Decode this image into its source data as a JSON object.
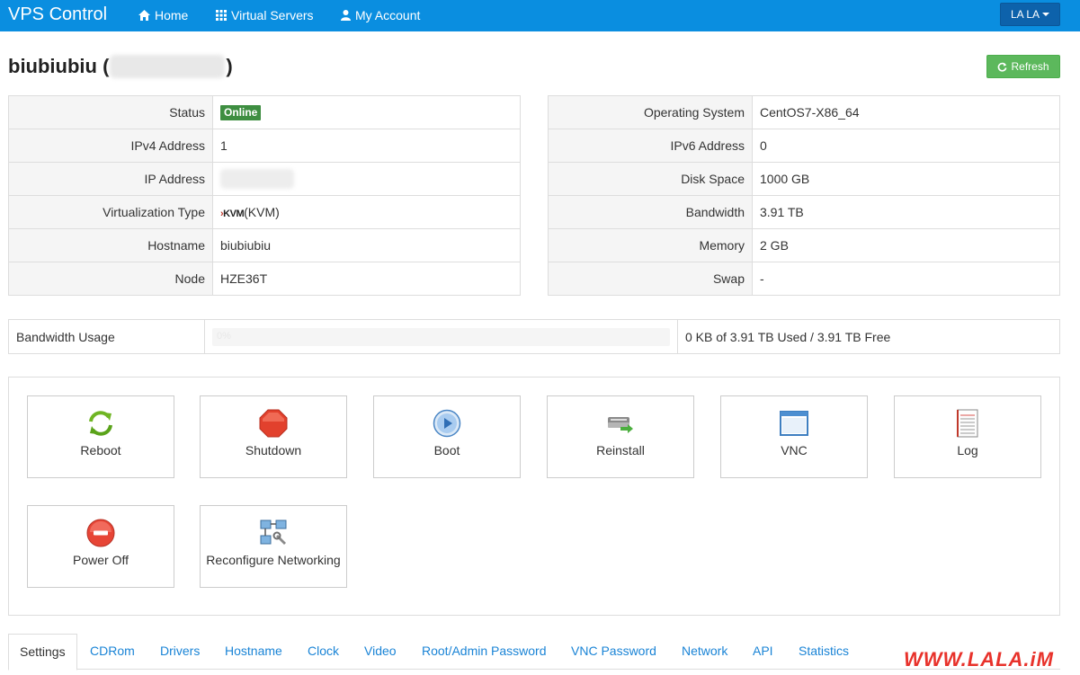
{
  "navbar": {
    "brand": "VPS Control",
    "items": [
      {
        "label": "Home",
        "icon": "home-icon"
      },
      {
        "label": "Virtual Servers",
        "icon": "grid-icon"
      },
      {
        "label": "My Account",
        "icon": "user-icon"
      }
    ],
    "user_menu": "LA LA",
    "color": "#0a8ee0"
  },
  "page": {
    "title_prefix": "biubiubiu (",
    "title_suffix": ")",
    "refresh_label": "Refresh"
  },
  "left_info": [
    {
      "label": "Status",
      "value": "Online",
      "type": "badge"
    },
    {
      "label": "IPv4 Address",
      "value": "1"
    },
    {
      "label": "IP Address",
      "value": "",
      "type": "redacted"
    },
    {
      "label": "Virtualization Type",
      "value": "(KVM)",
      "logo_text": "KVM"
    },
    {
      "label": "Hostname",
      "value": "biubiubiu"
    },
    {
      "label": "Node",
      "value": "HZE36T"
    }
  ],
  "right_info": [
    {
      "label": "Operating System",
      "value": "CentOS7-X86_64"
    },
    {
      "label": "IPv6 Address",
      "value": "0"
    },
    {
      "label": "Disk Space",
      "value": "1000 GB"
    },
    {
      "label": "Bandwidth",
      "value": "3.91 TB"
    },
    {
      "label": "Memory",
      "value": "2 GB"
    },
    {
      "label": "Swap",
      "value": "-"
    }
  ],
  "bandwidth": {
    "label": "Bandwidth Usage",
    "percent_text": "0%",
    "percent": 0,
    "summary": "0 KB of 3.91 TB Used / 3.91 TB Free"
  },
  "actions": [
    {
      "label": "Reboot",
      "icon": "reboot-icon"
    },
    {
      "label": "Shutdown",
      "icon": "shutdown-icon"
    },
    {
      "label": "Boot",
      "icon": "boot-icon"
    },
    {
      "label": "Reinstall",
      "icon": "reinstall-icon"
    },
    {
      "label": "VNC",
      "icon": "vnc-icon"
    },
    {
      "label": "Log",
      "icon": "log-icon"
    },
    {
      "label": "Power Off",
      "icon": "power-off-icon"
    },
    {
      "label": "Reconfigure Networking",
      "icon": "network-icon"
    }
  ],
  "tabs": [
    {
      "label": "Settings",
      "active": true
    },
    {
      "label": "CDRom"
    },
    {
      "label": "Drivers"
    },
    {
      "label": "Hostname"
    },
    {
      "label": "Clock"
    },
    {
      "label": "Video"
    },
    {
      "label": "Root/Admin Password"
    },
    {
      "label": "VNC Password"
    },
    {
      "label": "Network"
    },
    {
      "label": "API"
    },
    {
      "label": "Statistics"
    }
  ],
  "watermark": "WWW.LALA.iM"
}
